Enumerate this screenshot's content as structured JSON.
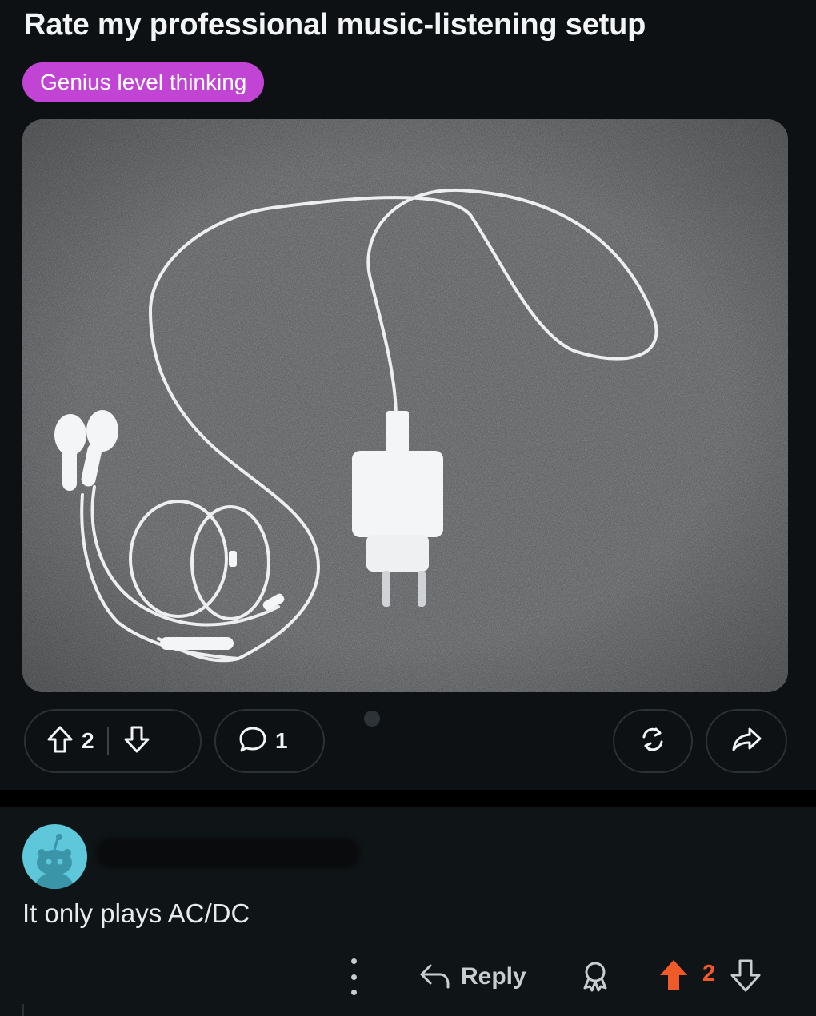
{
  "post": {
    "title": "Rate my professional music-listening setup",
    "flair": "Genius level thinking",
    "flair_color": "#c144d4",
    "image": {
      "description_icon": "earphones-and-charger-photo"
    },
    "votes": "2",
    "comments": "1"
  },
  "comment": {
    "avatar_icon": "snoo-avatar-icon",
    "text": "It only plays AC/DC",
    "reply_label": "Reply",
    "score": "2",
    "upvoted_color": "#f05a28"
  }
}
